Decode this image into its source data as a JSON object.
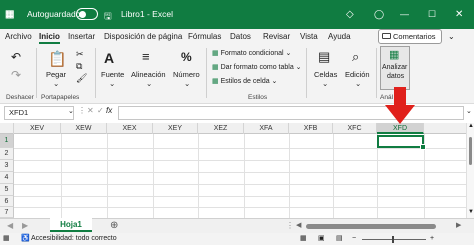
{
  "titlebar": {
    "autosave": "Autoguardado",
    "title": "Libro1 - Excel"
  },
  "tabs": [
    "Archivo",
    "Inicio",
    "Insertar",
    "Disposición de página",
    "Fórmulas",
    "Datos",
    "Revisar",
    "Vista",
    "Ayuda"
  ],
  "comments_label": "Comentarios",
  "ribbon": {
    "undo_group": "Deshacer",
    "clipboard": {
      "paste": "Pegar",
      "group": "Portapapeles"
    },
    "font": "Fuente",
    "alignment": "Alineación",
    "number": "Número",
    "styles": {
      "conditional": "Formato condicional",
      "as_table": "Dar formato como tabla",
      "cell_styles": "Estilos de celda",
      "group": "Estilos"
    },
    "cells": "Celdas",
    "editing": "Edición",
    "analyze": {
      "line1": "Analizar",
      "line2": "datos",
      "group": "Anál"
    }
  },
  "formula_bar": {
    "namebox": "XFD1",
    "fx": "fx"
  },
  "columns": [
    "XEV",
    "XEW",
    "XEX",
    "XEY",
    "XEZ",
    "XFA",
    "XFB",
    "XFC",
    "XFD"
  ],
  "selected_column": "XFD",
  "rows": [
    "1",
    "2",
    "3",
    "4",
    "5",
    "6",
    "7"
  ],
  "sheet_tab": "Hoja1",
  "status": {
    "accessibility": "Accesibilidad: todo correcto"
  },
  "colors": {
    "excel_green": "#107c41",
    "arrow_red": "#e0201b"
  }
}
